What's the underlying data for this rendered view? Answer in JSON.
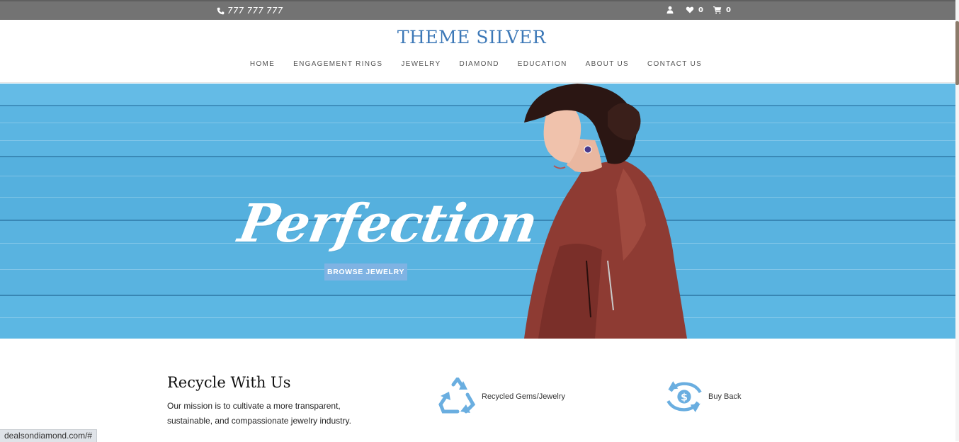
{
  "topbar": {
    "phone": "777 777 777",
    "wishlist_count": "0",
    "cart_count": "0",
    "icons": [
      "phone-icon",
      "user-icon",
      "heart-icon",
      "cart-icon"
    ]
  },
  "header": {
    "logo": "THEME SILVER",
    "nav": [
      "HOME",
      "ENGAGEMENT RINGS",
      "JEWELRY",
      "DIAMOND",
      "EDUCATION",
      "ABOUT US",
      "CONTACT US"
    ]
  },
  "hero": {
    "headline": "Perfection",
    "button_label": "BROWSE JEWELRY"
  },
  "recycle": {
    "title": "Recycle With Us",
    "text": "Our mission is to cultivate a more transparent, sustainable, and compassionate jewelry industry."
  },
  "features": [
    {
      "label": "Recycled Gems/Jewelry",
      "icon": "recycle-icon"
    },
    {
      "label": "Buy Back",
      "icon": "buy-back-dollar-icon"
    }
  ],
  "status_bar": {
    "url": "dealsondiamond.com/#"
  },
  "colors": {
    "topbar": "#737373",
    "brand": "#3c78b7",
    "hero_bg": "#58b3e1",
    "button": "#7fb3e3",
    "icon_blue": "#6aaee0"
  }
}
